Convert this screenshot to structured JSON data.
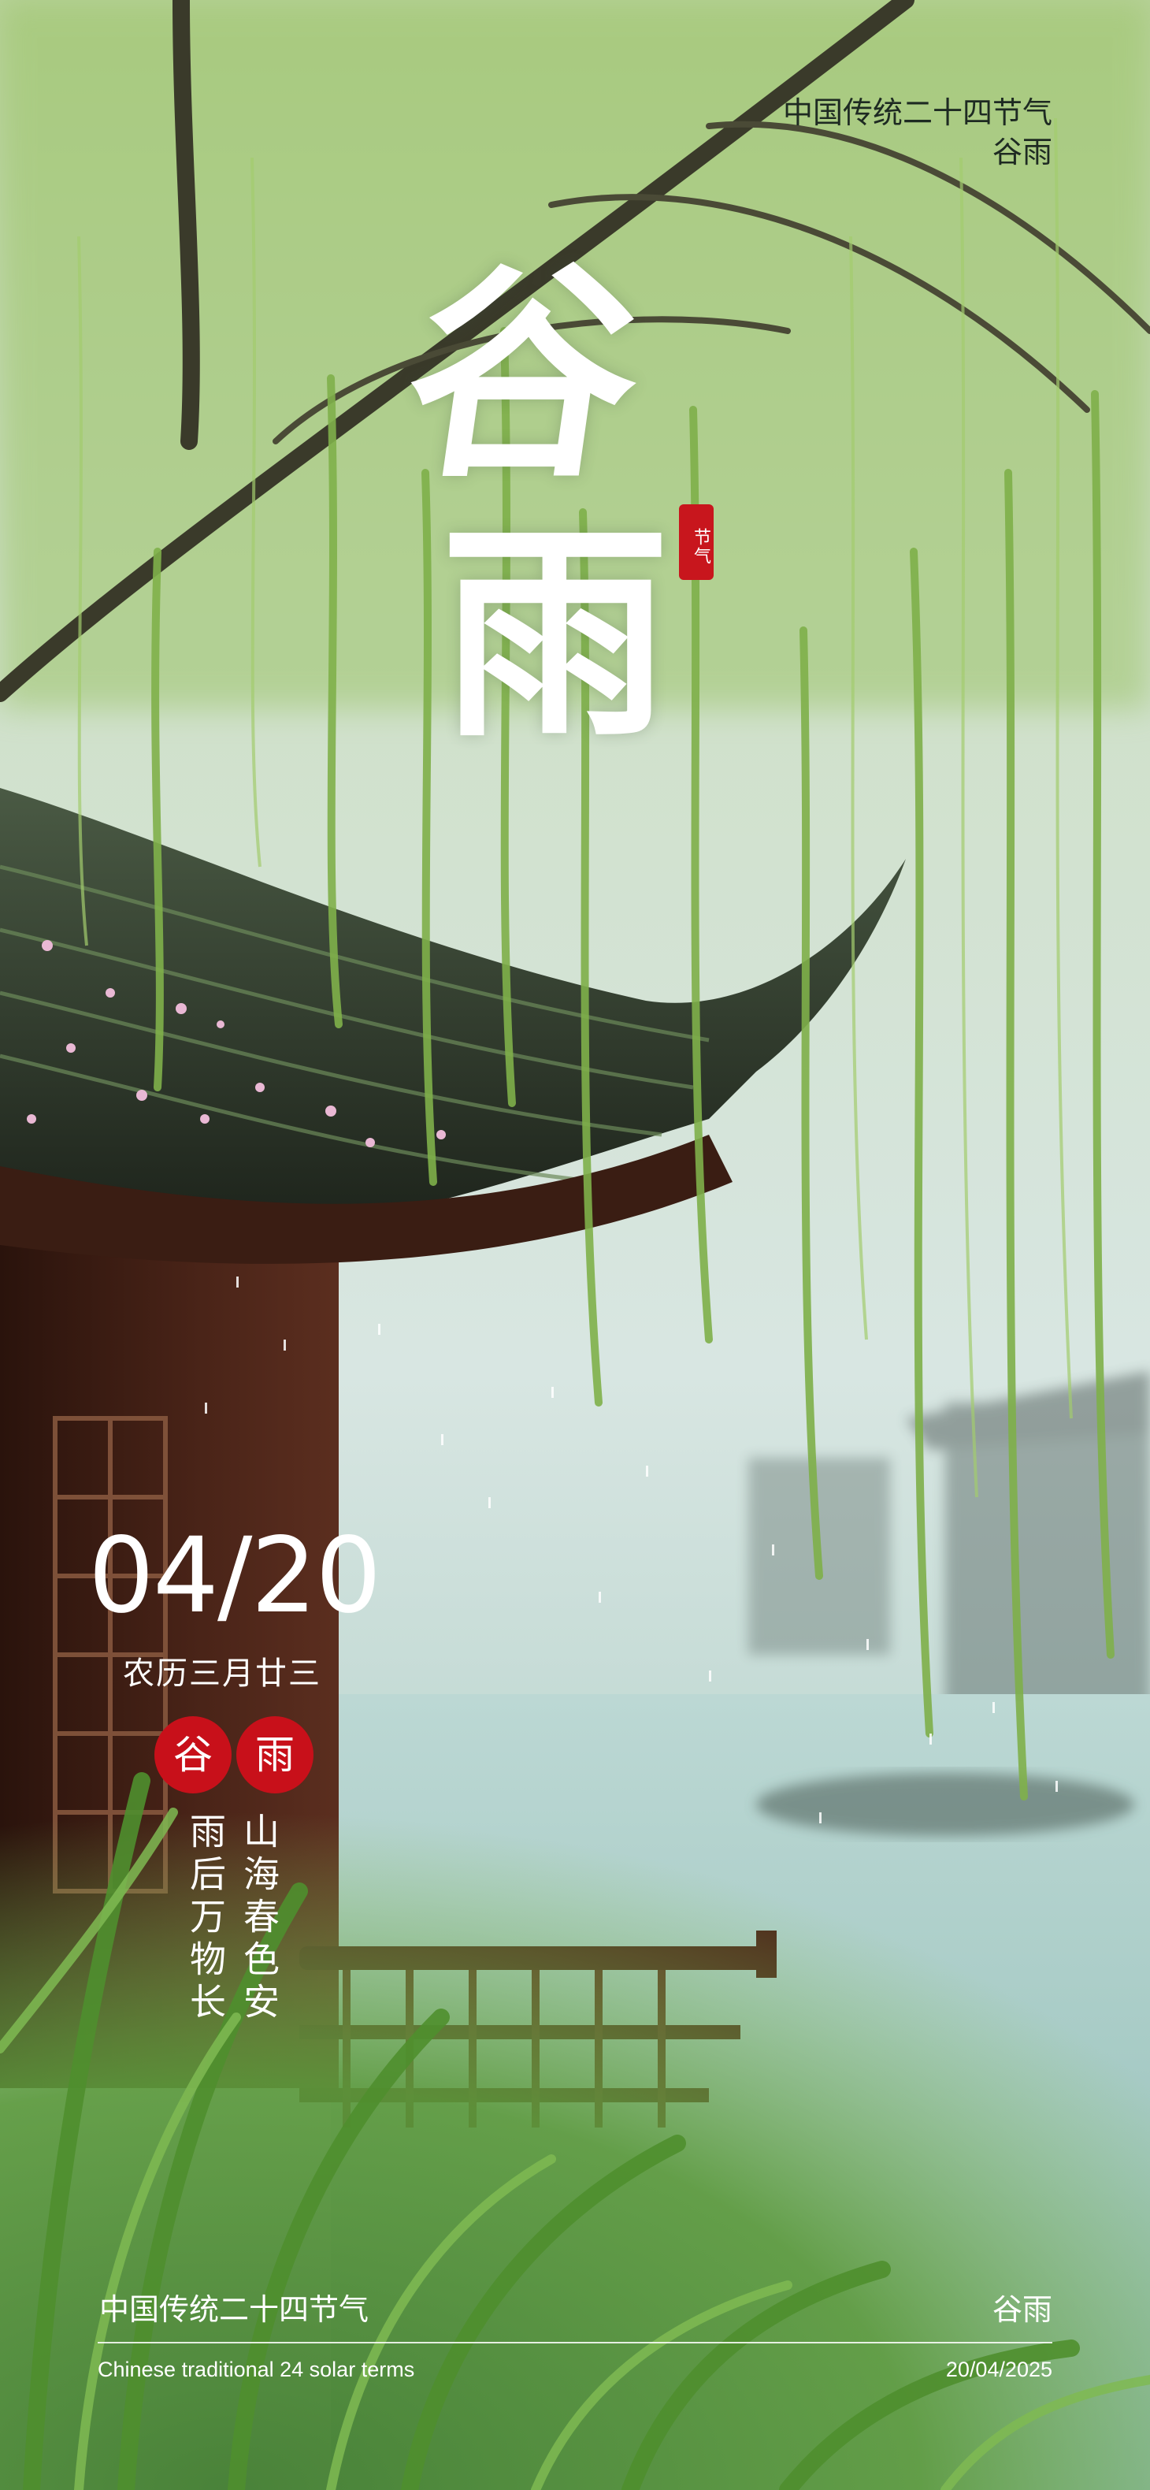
{
  "header": {
    "caption_line1": "中国传统二十四节气",
    "caption_line2": "谷雨"
  },
  "title": {
    "char1": "谷",
    "char2": "雨",
    "seal_text": "节气"
  },
  "date": {
    "gregorian": "04/20",
    "lunar": "农历三月廿三"
  },
  "badges": [
    "谷",
    "雨"
  ],
  "verses": {
    "col1": "雨后万物长",
    "col2": "山海春色安"
  },
  "footer": {
    "left_title": "中国传统二十四节气",
    "right_title": "谷雨",
    "left_sub": "Chinese traditional 24 solar terms",
    "right_sub": "20/04/2025"
  },
  "colors": {
    "accent_red": "#c8101a",
    "willow_green": "#7fb04a",
    "mist": "#dfe9e4",
    "roof_dark": "#2b2e26",
    "wood": "#4a2418"
  }
}
